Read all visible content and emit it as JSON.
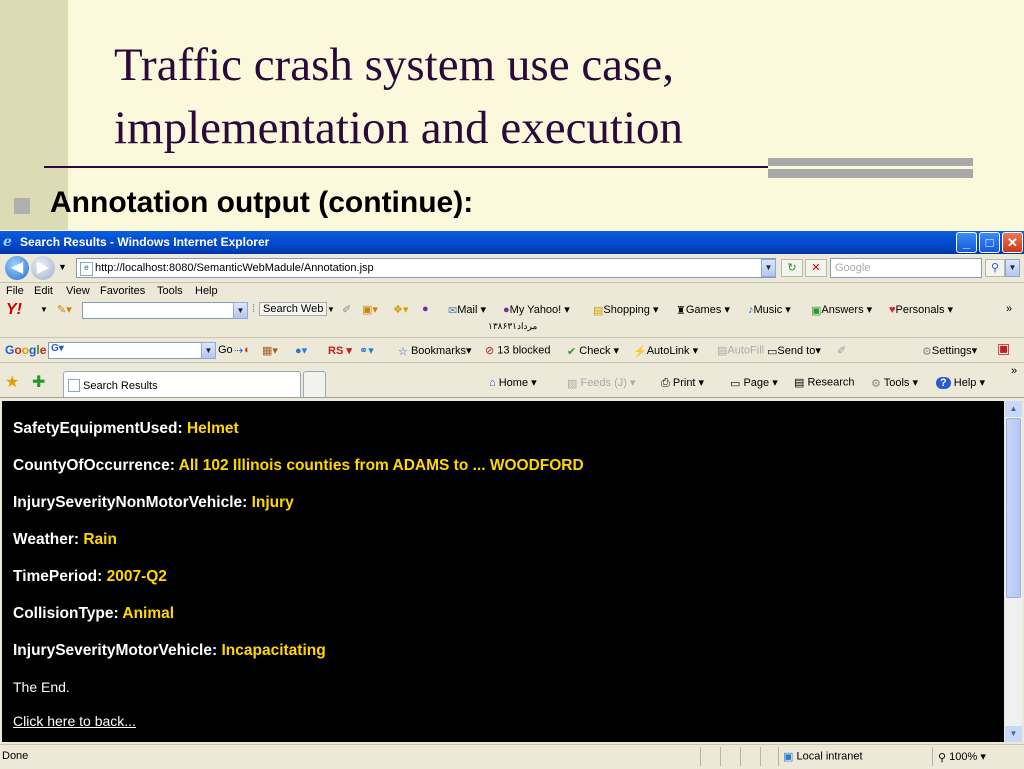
{
  "slide": {
    "title_line1": "Traffic crash system use case,",
    "title_line2": "implementation and execution",
    "subtitle": "Annotation output (continue):"
  },
  "window": {
    "title": "Search Results - Windows Internet Explorer",
    "minimize": "_",
    "maximize": "□",
    "close": "✕"
  },
  "address": {
    "url": "http://localhost:8080/SemanticWebMadule/Annotation.jsp",
    "search_placeholder": "Google"
  },
  "menu": [
    "File",
    "Edit",
    "View",
    "Favorites",
    "Tools",
    "Help"
  ],
  "yahoo_toolbar": {
    "logo": "Y!",
    "search_web": "Search Web",
    "items": [
      "Mail",
      "My Yahoo!",
      "Shopping",
      "Games",
      "Music",
      "Answers",
      "Personals"
    ],
    "persian_date": "۱۳۸۶مرداد۳۱",
    "more": "»"
  },
  "google_toolbar": {
    "logo": "Google",
    "go": "Go",
    "bookmarks": "Bookmarks",
    "blocked": "13 blocked",
    "check": "Check",
    "autolink": "AutoLink",
    "autofill": "AutoFill",
    "send_to": "Send to",
    "settings": "Settings"
  },
  "tabs": {
    "active": "Search Results"
  },
  "command_bar": {
    "home": "Home",
    "feeds": "Feeds (J)",
    "print": "Print",
    "page": "Page",
    "research": "Research",
    "tools": "Tools",
    "help": "Help"
  },
  "annotation": [
    {
      "key": "SafetyEquipmentUsed:",
      "value": "Helmet"
    },
    {
      "key": "CountyOfOccurrence:",
      "value": "All 102 Illinois counties from ADAMS to ... WOODFORD"
    },
    {
      "key": "InjurySeverityNonMotorVehicle:",
      "value": "Injury"
    },
    {
      "key": "Weather:",
      "value": "Rain"
    },
    {
      "key": "TimePeriod:",
      "value": "2007-Q2"
    },
    {
      "key": "CollisionType:",
      "value": "Animal"
    },
    {
      "key": "InjurySeverityMotorVehicle:",
      "value": "Incapacitating"
    }
  ],
  "end_text": "The End.",
  "back_link": "Click here to back...",
  "status": {
    "left": "Done",
    "zone": "Local intranet",
    "zoom": "100%"
  },
  "colors": {
    "slide_background": "#fbf8dc",
    "title_color": "#2a0a3a",
    "content_background": "#000000",
    "value_color": "#ffd700"
  }
}
